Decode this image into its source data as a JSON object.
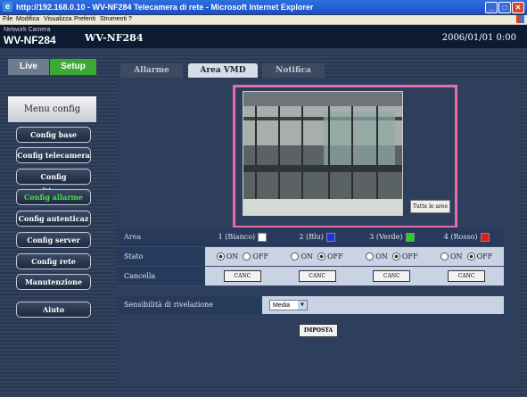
{
  "window": {
    "title": "http://192.168.0.10 - WV-NF284 Telecamera di rete - Microsoft Internet Explorer"
  },
  "menu": [
    "File",
    "Modifica",
    "Visualizza",
    "Preferiti",
    "Strumenti",
    "?"
  ],
  "header": {
    "brand": "Network Camera",
    "model": "WV-NF284",
    "title": "WV-NF284",
    "datetime": "2006/01/01 0:00"
  },
  "sidebar": {
    "live": "Live",
    "setup": "Setup",
    "menu_title": "Menu config",
    "items": [
      "Config base",
      "Config telecamera",
      "Config multiscreen",
      "Config allarme",
      "Config autenticaz",
      "Config server",
      "Config rete",
      "Manutenzione",
      "Aiuto"
    ],
    "active_index": 3
  },
  "tabs": [
    "Allarme",
    "Area VMD",
    "Notifica"
  ],
  "active_tab": 1,
  "viewer": {
    "all_areas_button": "Tutte le aree"
  },
  "areas": {
    "header_label": "Area",
    "names": [
      "1 (Bianco)",
      "2 (Blu)",
      "3 (Verde)",
      "4 (Rosso)"
    ],
    "colors": [
      "#ffffff",
      "#1a32e8",
      "#29d029",
      "#e81a1a"
    ],
    "stato_label": "Stato",
    "on_label": "ON",
    "off_label": "OFF",
    "stato_values": [
      "ON",
      "OFF",
      "OFF",
      "OFF"
    ],
    "cancella_label": "Cancella",
    "canc_button": "CANC"
  },
  "sensitivity": {
    "label": "Sensibilità di rivelazione",
    "value": "Media"
  },
  "submit": "IMPOSTA"
}
